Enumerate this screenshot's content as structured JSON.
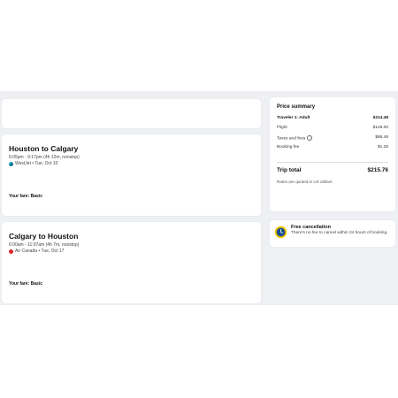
{
  "flights": [
    {
      "title": "Houston to Calgary",
      "details": "6:05pm - 9:17pm (4h 12m, nonstop)",
      "airline": "WestJet • Tue, Oct 10",
      "fare": "Your fare: Basic"
    },
    {
      "title": "Calgary to Houston",
      "details": "6:00am - 11:07am (4h 7m, nonstop)",
      "airline": "Air Canada • Tue, Oct 17",
      "fare": "Your fare: Basic"
    }
  ],
  "price_summary": {
    "title": "Price summary",
    "traveler_label": "Traveler 1: Adult",
    "traveler_value": "$214.48",
    "flight_label": "Flight",
    "flight_value": "$128.00",
    "taxes_label": "Taxes and fees",
    "taxes_value": "$86.48",
    "booking_label": "Booking fee",
    "booking_value": "$1.28",
    "total_label": "Trip total",
    "total_value": "$215.76",
    "note": "Rates are quoted in US dollars"
  },
  "cancellation": {
    "title": "Free cancellation",
    "text": "There's no fee to cancel within 24 hours of booking."
  },
  "colors": {
    "background_band": "#eef0f3",
    "clock_accent": "#f5c400",
    "clock_face": "#1a4f8b"
  }
}
